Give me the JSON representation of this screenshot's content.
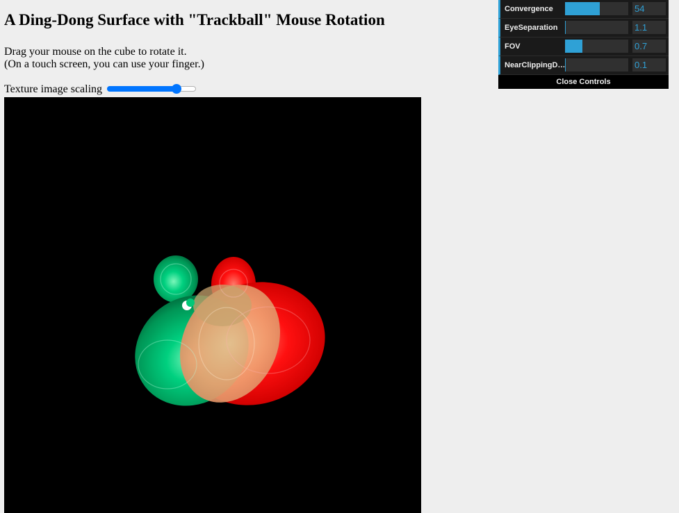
{
  "page": {
    "title": "A Ding-Dong Surface with \"Trackball\" Mouse Rotation",
    "instructions_line1": "Drag your mouse on the cube to rotate it.",
    "instructions_line2": "(On a touch screen, you can use your finger.)"
  },
  "texture_scaling": {
    "label": "Texture image scaling",
    "value_fraction": 0.82
  },
  "gui": {
    "controls": [
      {
        "label": "Convergence",
        "value": "54",
        "fill_fraction": 0.55
      },
      {
        "label": "EyeSeparation",
        "value": "1.1",
        "fill_fraction": 0.01
      },
      {
        "label": "FOV",
        "value": "0.7",
        "fill_fraction": 0.28
      },
      {
        "label": "NearClippingDis...",
        "value": "0.1",
        "fill_fraction": 0.01
      }
    ],
    "close_label": "Close Controls",
    "accent_color": "#2fa1d6"
  },
  "scene": {
    "background_color": "#000000",
    "left_eye_color": "#00c878",
    "right_eye_color": "#ff1a1a"
  }
}
